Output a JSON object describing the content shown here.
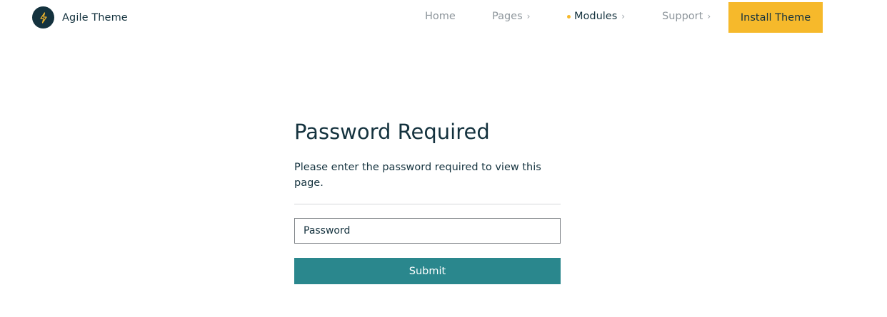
{
  "header": {
    "brand_name": "Agile Theme",
    "logo_icon": "lightning-bolt-icon",
    "nav": {
      "home": "Home",
      "pages": "Pages",
      "modules": "Modules",
      "support": "Support"
    },
    "chevron_glyph": "›",
    "cta_label": "Install Theme"
  },
  "main": {
    "title": "Password Required",
    "subtitle": "Please enter the password required to view this page.",
    "password_placeholder": "Password",
    "password_value": "",
    "submit_label": "Submit"
  },
  "colors": {
    "navy": "#14323e",
    "accent_yellow": "#f6b92b",
    "teal": "#2a878d",
    "nav_muted": "#8d959b"
  }
}
